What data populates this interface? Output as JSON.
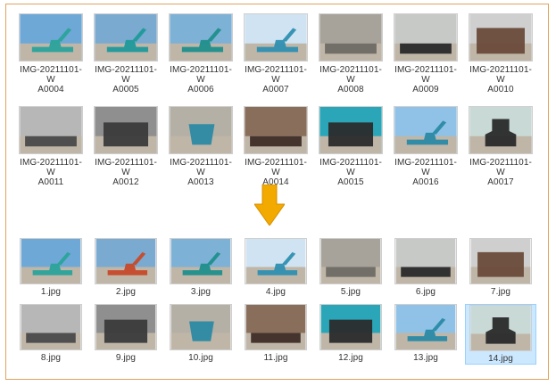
{
  "top_files": [
    {
      "name": "IMG-20211101-WA0004",
      "icon": "excavator-photo-icon",
      "colors": [
        "#6ea8d6",
        "#2aa39a"
      ]
    },
    {
      "name": "IMG-20211101-WA0005",
      "icon": "excavator-photo-icon",
      "colors": [
        "#7aaad0",
        "#1f9a9a"
      ]
    },
    {
      "name": "IMG-20211101-WA0006",
      "icon": "excavator-photo-icon",
      "colors": [
        "#7db1d6",
        "#1f8f8b"
      ]
    },
    {
      "name": "IMG-20211101-WA0007",
      "icon": "excavator-photo-icon",
      "colors": [
        "#cfe3f2",
        "#2f8fb0"
      ]
    },
    {
      "name": "IMG-20211101-WA0008",
      "icon": "track-photo-icon",
      "colors": [
        "#a7a39b",
        "#6e6a64"
      ]
    },
    {
      "name": "IMG-20211101-WA0009",
      "icon": "track-photo-icon",
      "colors": [
        "#c7c9c7",
        "#2a2a2a"
      ]
    },
    {
      "name": "IMG-20211101-WA0010",
      "icon": "interior-photo-icon",
      "colors": [
        "#cfcfcf",
        "#6a4b3a"
      ]
    },
    {
      "name": "IMG-20211101-WA0011",
      "icon": "track-photo-icon",
      "colors": [
        "#b7b7b7",
        "#4a4a4a"
      ]
    },
    {
      "name": "IMG-20211101-WA0012",
      "icon": "engine-photo-icon",
      "colors": [
        "#8f8f8f",
        "#3b3b3b"
      ]
    },
    {
      "name": "IMG-20211101-WA0013",
      "icon": "bucket-photo-icon",
      "colors": [
        "#b4b0a6",
        "#2c8aa3"
      ]
    },
    {
      "name": "IMG-20211101-WA0014",
      "icon": "track-photo-icon",
      "colors": [
        "#8a6e5c",
        "#3e2d26"
      ]
    },
    {
      "name": "IMG-20211101-WA0015",
      "icon": "engine-photo-icon",
      "colors": [
        "#2aa6b8",
        "#2b2b2b"
      ]
    },
    {
      "name": "IMG-20211101-WA0016",
      "icon": "excavator-photo-icon",
      "colors": [
        "#8fc2e6",
        "#2b8aa5"
      ]
    },
    {
      "name": "IMG-20211101-WA0017",
      "icon": "seat-photo-icon",
      "colors": [
        "#c9d9d6",
        "#2a2a2a"
      ]
    }
  ],
  "bottom_files": [
    {
      "name": "1.jpg",
      "icon": "excavator-photo-icon",
      "colors": [
        "#6ea8d6",
        "#2aa39a"
      ]
    },
    {
      "name": "2.jpg",
      "icon": "excavator-photo-icon",
      "colors": [
        "#7aaad0",
        "#c74a2a"
      ]
    },
    {
      "name": "3.jpg",
      "icon": "excavator-photo-icon",
      "colors": [
        "#7db1d6",
        "#1f8f8b"
      ]
    },
    {
      "name": "4.jpg",
      "icon": "excavator-photo-icon",
      "colors": [
        "#cfe3f2",
        "#2f8fb0"
      ]
    },
    {
      "name": "5.jpg",
      "icon": "track-photo-icon",
      "colors": [
        "#a7a39b",
        "#6e6a64"
      ]
    },
    {
      "name": "6.jpg",
      "icon": "track-photo-icon",
      "colors": [
        "#c7c9c7",
        "#2a2a2a"
      ]
    },
    {
      "name": "7.jpg",
      "icon": "interior-photo-icon",
      "colors": [
        "#cfcfcf",
        "#6a4b3a"
      ]
    },
    {
      "name": "8.jpg",
      "icon": "track-photo-icon",
      "colors": [
        "#b7b7b7",
        "#4a4a4a"
      ]
    },
    {
      "name": "9.jpg",
      "icon": "engine-photo-icon",
      "colors": [
        "#8f8f8f",
        "#3b3b3b"
      ]
    },
    {
      "name": "10.jpg",
      "icon": "bucket-photo-icon",
      "colors": [
        "#b4b0a6",
        "#2c8aa3"
      ]
    },
    {
      "name": "11.jpg",
      "icon": "track-photo-icon",
      "colors": [
        "#8a6e5c",
        "#3e2d26"
      ]
    },
    {
      "name": "12.jpg",
      "icon": "engine-photo-icon",
      "colors": [
        "#2aa6b8",
        "#2b2b2b"
      ]
    },
    {
      "name": "13.jpg",
      "icon": "excavator-photo-icon",
      "colors": [
        "#8fc2e6",
        "#2b8aa5"
      ]
    },
    {
      "name": "14.jpg",
      "icon": "seat-photo-icon",
      "colors": [
        "#c9d9d6",
        "#2a2a2a"
      ],
      "selected": true
    }
  ],
  "arrow": {
    "icon": "arrow-down-icon",
    "color": "#f2a900"
  },
  "frame_color": "#e0a35c"
}
